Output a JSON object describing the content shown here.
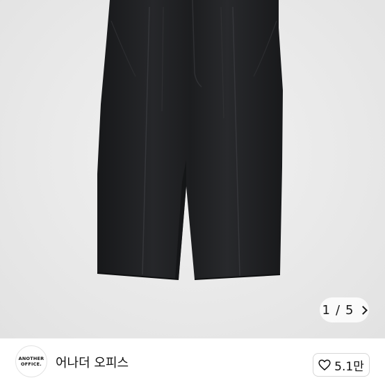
{
  "product": {
    "image_alt": "Black wide pleated trousers"
  },
  "gallery": {
    "current": "1",
    "separator": "/",
    "total": "5"
  },
  "shop": {
    "logo_line1": "ANOTHER",
    "logo_line2": "OFFICE.",
    "name": "어나더 오피스"
  },
  "like": {
    "count": "5.1만"
  },
  "colors": {
    "background": "#e9e9e9",
    "garment": "#1e1f21",
    "text": "#111111"
  }
}
